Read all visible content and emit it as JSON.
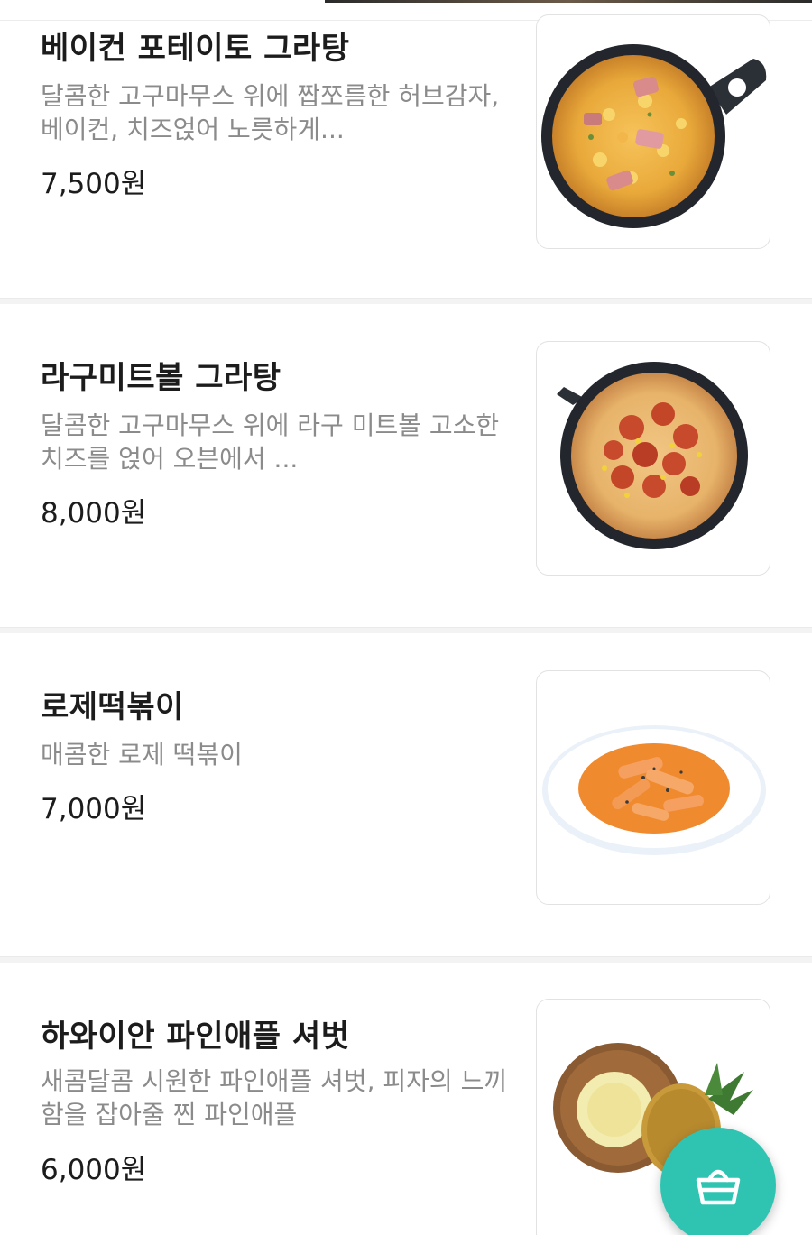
{
  "menu": {
    "items": [
      {
        "name": "베이컨 포테이토 그라탕",
        "desc": "달콤한 고구마무스 위에 짭쪼름한 허브감자,베이컨, 치즈얹어 노릇하게...",
        "price": "7,500원",
        "image_icon": "bacon-potato-gratin-photo"
      },
      {
        "name": "라구미트볼 그라탕",
        "desc": "달콤한 고구마무스 위에 라구 미트볼 고소한 치즈를 얹어 오븐에서 ...",
        "price": "8,000원",
        "image_icon": "ragu-meatball-gratin-photo"
      },
      {
        "name": "로제떡볶이",
        "desc": "매콤한 로제 떡볶이",
        "price": "7,000원",
        "image_icon": "rose-tteokbokki-photo"
      },
      {
        "name": "하와이안 파인애플 셔벗",
        "desc": "새콤달콤 시원한 파인애플 셔벗, 피자의 느끼함을 잡아줄 찐 파인애플",
        "price": "6,000원",
        "image_icon": "pineapple-sherbet-photo"
      }
    ]
  },
  "cart_button": {
    "icon": "shopping-basket-icon",
    "color": "#2fc4b2"
  }
}
